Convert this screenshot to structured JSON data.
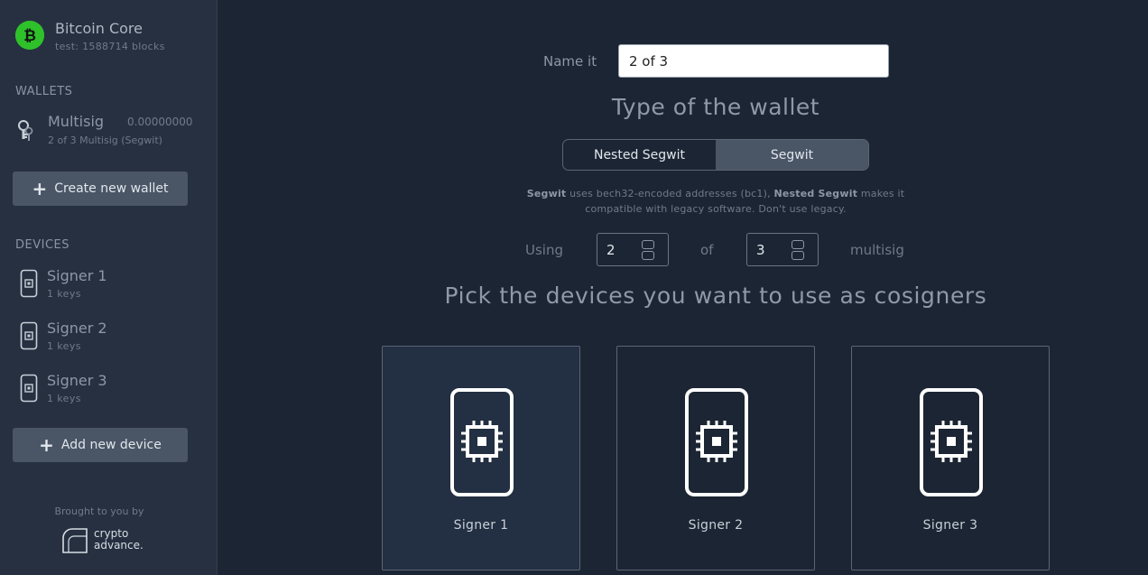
{
  "app": {
    "title": "Bitcoin Core",
    "subtitle": "test: 1588714 blocks",
    "accent_color": "#2ec12a"
  },
  "sidebar": {
    "wallets_label": "WALLETS",
    "wallets": [
      {
        "name": "Multisig",
        "balance": "0.00000000",
        "description": "2 of 3 Multisig (Segwit)",
        "icon": "keys-icon"
      }
    ],
    "create_wallet_label": "Create new wallet",
    "devices_label": "DEVICES",
    "devices": [
      {
        "name": "Signer 1",
        "keys": "1 keys",
        "icon": "device-icon"
      },
      {
        "name": "Signer 2",
        "keys": "1 keys",
        "icon": "device-icon"
      },
      {
        "name": "Signer 3",
        "keys": "1 keys",
        "icon": "device-icon"
      }
    ],
    "add_device_label": "Add new device",
    "footer": {
      "brought_by": "Brought to you by",
      "brand_line1": "crypto",
      "brand_line2": "advance."
    }
  },
  "main": {
    "name_label": "Name it",
    "name_value": "2 of 3",
    "type_title": "Type of the wallet",
    "type_options": [
      {
        "label": "Nested Segwit",
        "active": false
      },
      {
        "label": "Segwit",
        "active": true
      }
    ],
    "description": {
      "segwit": "Segwit",
      "part1": " uses bech32-encoded addresses (bc1), ",
      "nested": "Nested Segwit",
      "part2": " makes it compatible with legacy software. Don't use legacy."
    },
    "using_label": "Using",
    "threshold": "2",
    "of_label": "of",
    "total": "3",
    "multisig_label": "multisig",
    "pick_title": "Pick the devices you want to use as cosigners",
    "cosigners": [
      {
        "name": "Signer 1",
        "selected": true
      },
      {
        "name": "Signer 2",
        "selected": false
      },
      {
        "name": "Signer 3",
        "selected": false
      }
    ]
  }
}
